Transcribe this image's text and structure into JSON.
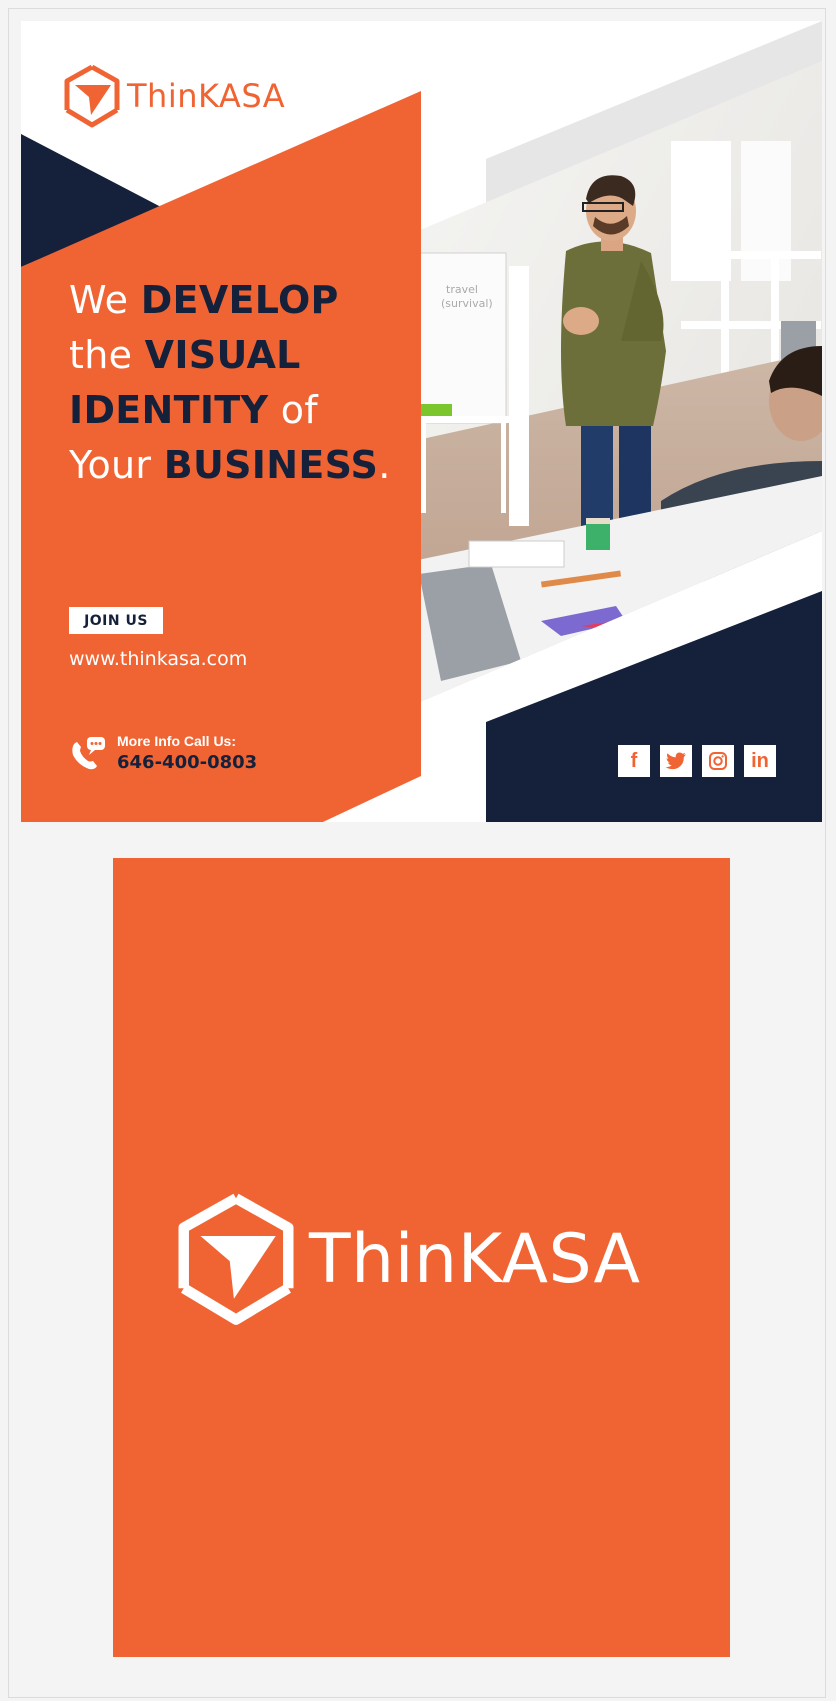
{
  "brand": {
    "name": "ThinKASA",
    "logo_icon": "hexagon-arrow-icon"
  },
  "flyer": {
    "headline": {
      "line1_light": "We ",
      "line1_bold": "DEVELOP",
      "line2_light": "the ",
      "line2_bold": "VISUAL",
      "line3_bold": "IDENTITY",
      "line3_light": " of",
      "line4_light": "Your ",
      "line4_bold": "BUSINESS",
      "line4_end": "."
    },
    "join_label": "JOIN US",
    "website": "www.thinkasa.com",
    "call_label": "More Info Call Us:",
    "phone": "646-400-0803",
    "socials": [
      {
        "name": "facebook-icon",
        "glyph": "f"
      },
      {
        "name": "twitter-icon",
        "glyph": ""
      },
      {
        "name": "instagram-icon",
        "glyph": ""
      },
      {
        "name": "linkedin-icon",
        "glyph": "in"
      }
    ]
  },
  "colors": {
    "orange": "#f06434",
    "navy": "#15213a",
    "white": "#ffffff"
  }
}
